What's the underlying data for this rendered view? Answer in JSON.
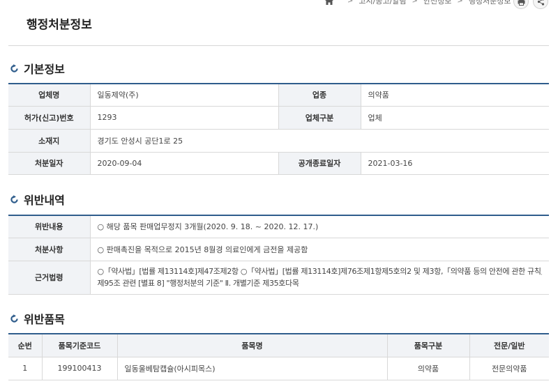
{
  "breadcrumb": {
    "items": [
      "고시/공고/알림",
      "안전정보",
      "행정처분정보"
    ]
  },
  "page_title": "행정처분정보",
  "basic_section": {
    "title": "기본정보",
    "labels": {
      "company": "업체명",
      "business_type": "업종",
      "license_no": "허가(신고)번호",
      "company_class": "업체구분",
      "address": "소재지",
      "disposal_date": "처분일자",
      "public_end_date": "공개종료일자"
    },
    "values": {
      "company": "일동제약(주)",
      "business_type": "의약품",
      "license_no": "1293",
      "company_class": "업체",
      "address": "경기도 안성시 공단1로 25",
      "disposal_date": "2020-09-04",
      "public_end_date": "2021-03-16"
    }
  },
  "violation_section": {
    "title": "위반내역",
    "labels": {
      "content": "위반내용",
      "matter": "처분사항",
      "law": "근거법령"
    },
    "values": {
      "content": "○ 해당 품목 판매업무정지 3개월(2020. 9. 18. ~ 2020. 12. 17.)",
      "matter": "○ 판매촉진을 목적으로 2015년 8월경 의료인에게 금전을 제공함",
      "law_line1": "○「약사법」[법률 제13114호]제47조제2항 ○「약사법」[법률 제13114호]제76조제1항제5호의2 및 제3항,「의약품 등의 안전에 관한 규칙」",
      "law_line2": "제95조 관련 [별표 8] \"행정처분의 기준\" Ⅱ. 개별기준 제35호다목"
    }
  },
  "products_section": {
    "title": "위반품목",
    "columns": [
      "순번",
      "품목기준코드",
      "품목명",
      "품목구분",
      "전문/일반"
    ],
    "rows": [
      [
        "1",
        "199100413",
        "일동울베탐캡슐(아시피목스)",
        "의약품",
        "전문의약품"
      ]
    ]
  },
  "colors": {
    "accent": "#2f5d8c",
    "header_bg": "#f1f3f6"
  },
  "icons": {
    "home": "home-icon",
    "print": "print-icon",
    "share": "share-icon",
    "section": "refresh-circle-icon"
  }
}
